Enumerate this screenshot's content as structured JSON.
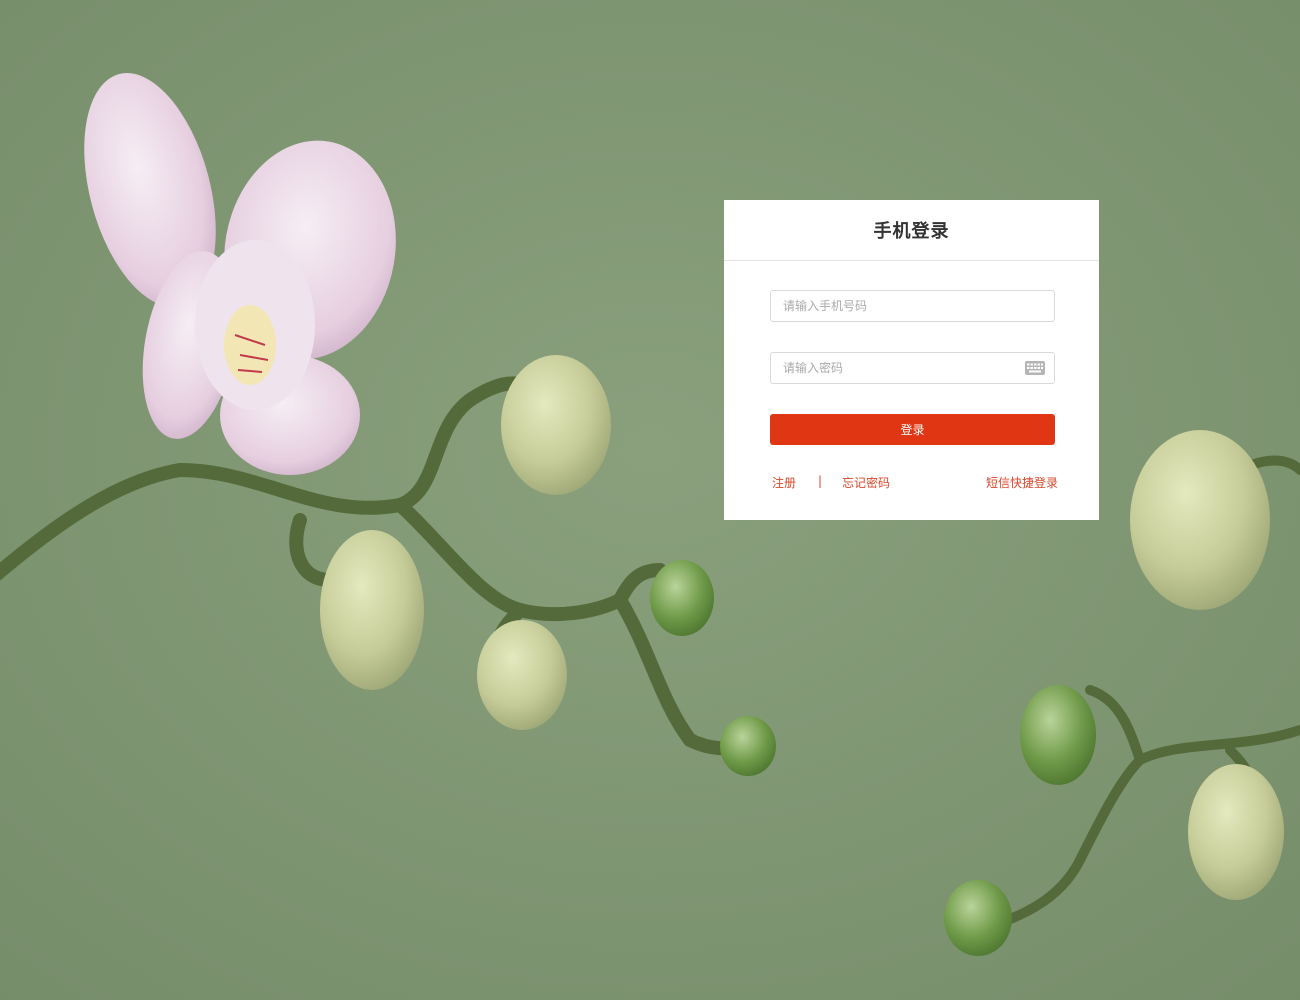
{
  "background": {
    "subject": "white orchid branch with buds",
    "color": "#7f9672"
  },
  "login": {
    "title": "手机登录",
    "phone_placeholder": "请输入手机号码",
    "password_placeholder": "请输入密码",
    "keyboard_icon": "keyboard-icon",
    "submit_label": "登录",
    "accent_color": "#e13614"
  },
  "links": {
    "register": "注册",
    "separator": "|",
    "forgot_password": "忘记密码",
    "sms_login": "短信快捷登录"
  }
}
